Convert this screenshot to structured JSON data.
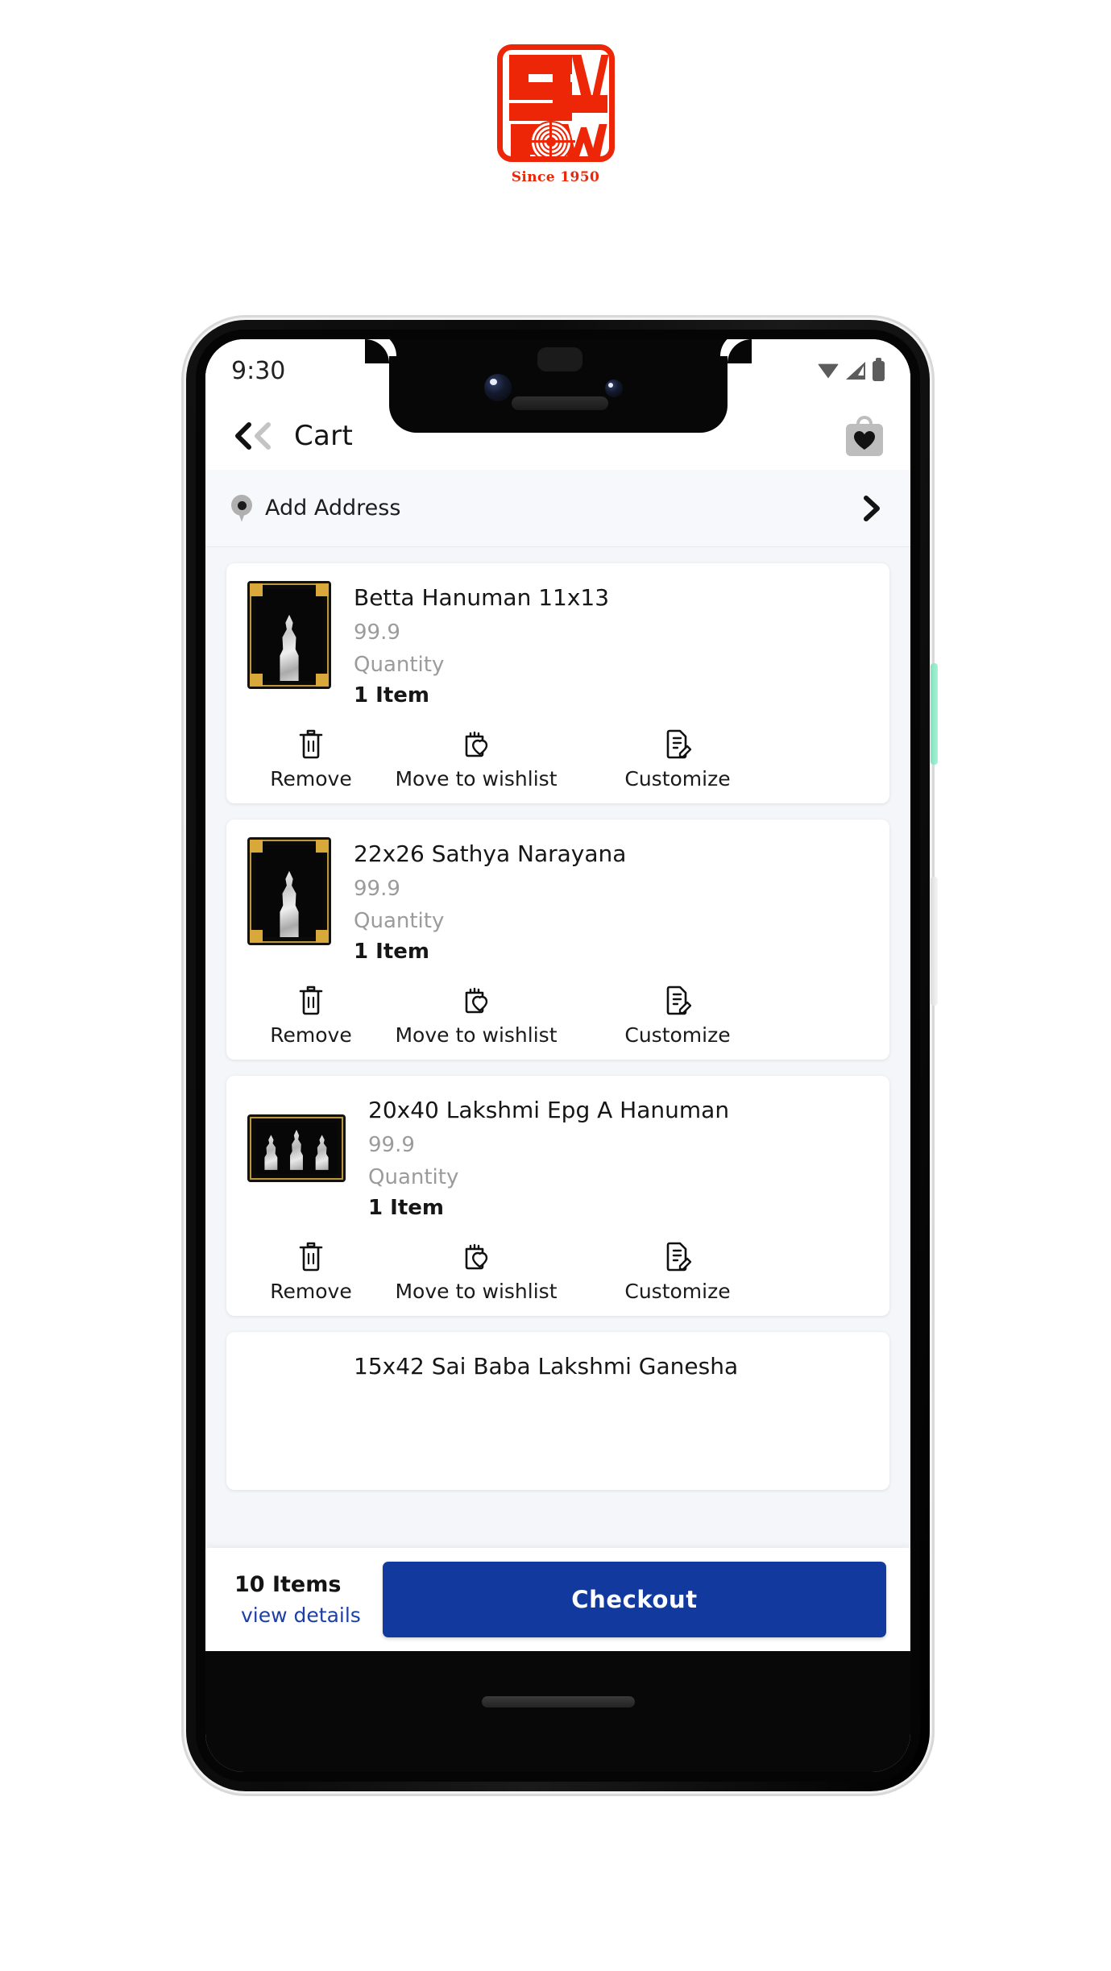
{
  "brand": {
    "logo_name": "slv-pw-logo",
    "letters": "SLV PW",
    "tagline": "Since 1950",
    "color": "#ED2607"
  },
  "phone": {
    "status_bar": {
      "time": "9:30",
      "icons": [
        "wifi-icon",
        "signal-icon",
        "battery-icon"
      ]
    },
    "side_buttons": {
      "power_color": "#8ee8c4",
      "volume_color": "#e6e6e6"
    }
  },
  "appbar": {
    "back_label": "back-double-chevron",
    "title": "Cart",
    "wishlist_icon": "wishlist-bag-heart-icon"
  },
  "address": {
    "icon": "location-pin-icon",
    "label": "Add Address",
    "arrow": "chevron-right-icon"
  },
  "cart": {
    "items": [
      {
        "name": "Betta Hanuman 11x13",
        "price": "99.9",
        "quantity_label": "Quantity",
        "quantity": "1 Item",
        "thumb": "portrait",
        "actions": [
          {
            "icon": "trash-icon",
            "label": "Remove"
          },
          {
            "icon": "bag-heart-icon",
            "label": "Move to wishlist"
          },
          {
            "icon": "document-pencil-icon",
            "label": "Customize"
          }
        ]
      },
      {
        "name": "22x26 Sathya Narayana",
        "price": "99.9",
        "quantity_label": "Quantity",
        "quantity": "1 Item",
        "thumb": "portrait",
        "actions": [
          {
            "icon": "trash-icon",
            "label": "Remove"
          },
          {
            "icon": "bag-heart-icon",
            "label": "Move to wishlist"
          },
          {
            "icon": "document-pencil-icon",
            "label": "Customize"
          }
        ]
      },
      {
        "name": "20x40 Lakshmi Epg A Hanuman",
        "price": "99.9",
        "quantity_label": "Quantity",
        "quantity": "1 Item",
        "thumb": "landscape",
        "actions": [
          {
            "icon": "trash-icon",
            "label": "Remove"
          },
          {
            "icon": "bag-heart-icon",
            "label": "Move to wishlist"
          },
          {
            "icon": "document-pencil-icon",
            "label": "Customize"
          }
        ]
      },
      {
        "name": "15x42 Sai Baba Lakshmi Ganesha",
        "price": "",
        "quantity_label": "",
        "quantity": "",
        "thumb": "portrait",
        "actions": []
      }
    ]
  },
  "bottom_bar": {
    "items_count": "10 Items",
    "details_link": "view details",
    "checkout_label": "Checkout",
    "checkout_color": "#123a9e"
  }
}
